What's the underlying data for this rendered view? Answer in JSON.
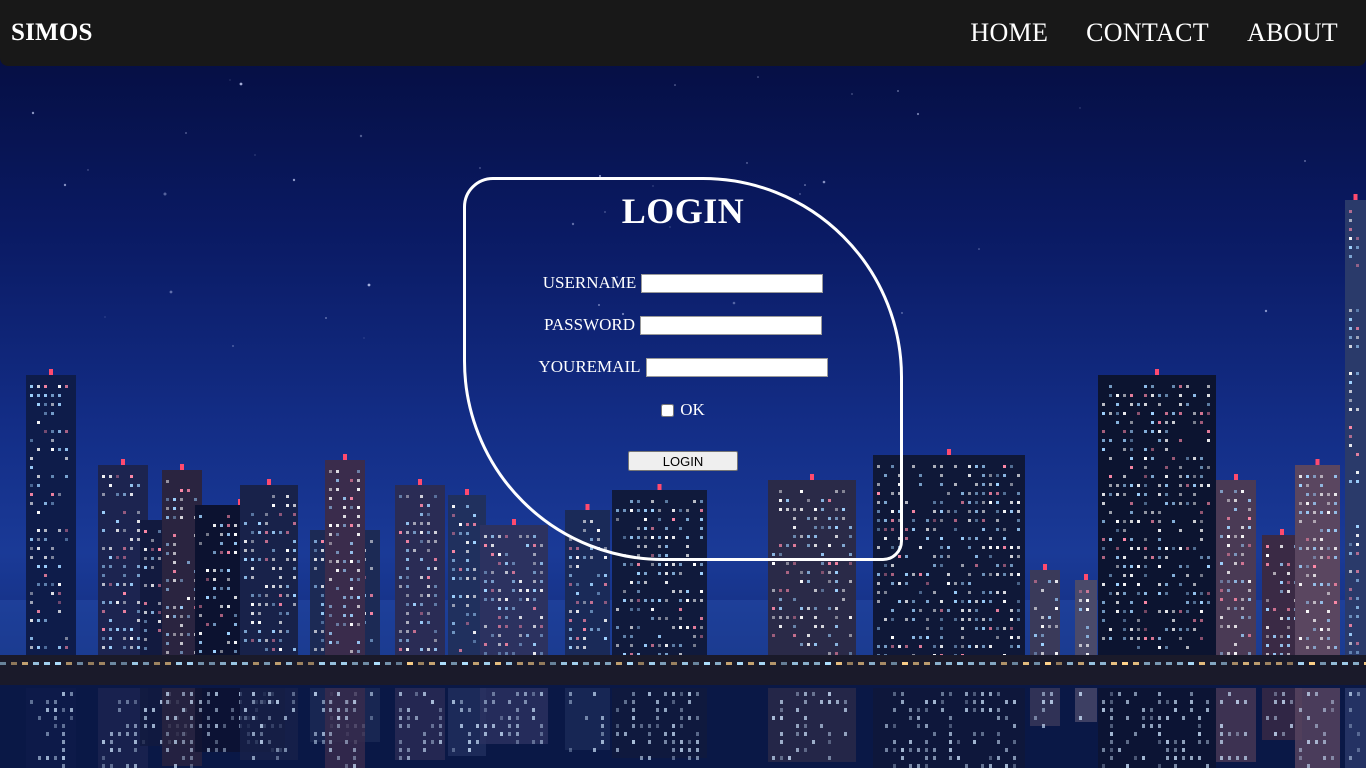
{
  "navbar": {
    "brand": "SIMOS",
    "links": [
      {
        "label": "HOME"
      },
      {
        "label": "CONTACT"
      },
      {
        "label": "ABOUT"
      }
    ]
  },
  "login": {
    "title": "LOGIN",
    "username_label": "USERNAME",
    "username_value": "",
    "password_label": "PASSWORD",
    "password_value": "",
    "email_label": "YOUREMAIL",
    "email_value": "",
    "checkbox_label": "OK",
    "checkbox_checked": false,
    "button_label": "LOGIN"
  },
  "colors": {
    "navbar_bg": "#181818",
    "text": "#ffffff",
    "sky_top": "#040b39",
    "sky_bottom": "#1a3a97"
  }
}
